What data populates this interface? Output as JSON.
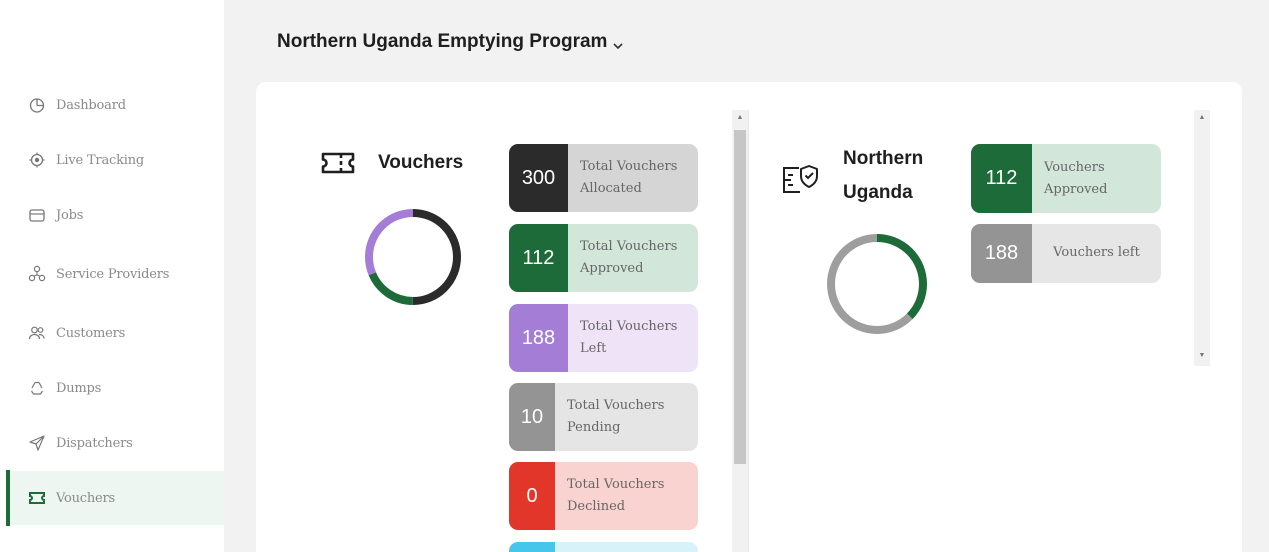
{
  "sidebar": {
    "items": [
      {
        "label": "Dashboard",
        "icon": "pie-chart-icon"
      },
      {
        "label": "Live Tracking",
        "icon": "target-icon"
      },
      {
        "label": "Jobs",
        "icon": "folder-icon"
      },
      {
        "label": "Service Providers",
        "icon": "providers-icon"
      },
      {
        "label": "Customers",
        "icon": "users-icon"
      },
      {
        "label": "Dumps",
        "icon": "recycle-icon"
      },
      {
        "label": "Dispatchers",
        "icon": "send-icon"
      },
      {
        "label": "Vouchers",
        "icon": "ticket-icon"
      }
    ],
    "active": "Vouchers"
  },
  "header": {
    "program": "Northern Uganda Emptying Program"
  },
  "vouchers": {
    "title": "Vouchers",
    "donut": [
      {
        "label": "Total Vouchers Allocated",
        "value": 300,
        "color": "#2b2b2b"
      },
      {
        "label": "Total Vouchers Approved",
        "value": 112,
        "color": "#1e6b3a"
      },
      {
        "label": "Total Vouchers Left",
        "value": 188,
        "color": "#a47ed6"
      }
    ],
    "stats": [
      {
        "value": "300",
        "line1": "Total Vouchers",
        "line2": "Allocated",
        "num_color": "#2b2b2b",
        "bg": "#d5d5d5"
      },
      {
        "value": "112",
        "line1": "Total Vouchers",
        "line2": "Approved",
        "num_color": "#1e6b3a",
        "bg": "#d2e6da"
      },
      {
        "value": "188",
        "line1": "Total Vouchers",
        "line2": "Left",
        "num_color": "#a47ed6",
        "bg": "#efe4f7"
      },
      {
        "value": "10",
        "line1": "Total Vouchers",
        "line2": "Pending",
        "num_color": "#949494",
        "bg": "#e5e5e5"
      },
      {
        "value": "0",
        "line1": "Total Vouchers",
        "line2": "Declined",
        "num_color": "#e3362b",
        "bg": "#f9d3d0"
      },
      {
        "value": "",
        "line1": "",
        "line2": "",
        "num_color": "#46c6ea",
        "bg": "#d8f2fa"
      }
    ]
  },
  "region": {
    "title_line1": "Northern",
    "title_line2": "Uganda",
    "donut": [
      {
        "label": "Vouchers Approved",
        "value": 112,
        "color": "#1e6b3a"
      },
      {
        "label": "Vouchers left",
        "value": 188,
        "color": "#9e9e9e"
      }
    ],
    "stats": [
      {
        "value": "112",
        "line1": "Vouchers",
        "line2": "Approved",
        "num_color": "#1e6b3a",
        "bg": "#d2e6da"
      },
      {
        "value": "188",
        "label": "Vouchers left",
        "num_color": "#949494",
        "bg": "#e6e6e6"
      }
    ]
  }
}
